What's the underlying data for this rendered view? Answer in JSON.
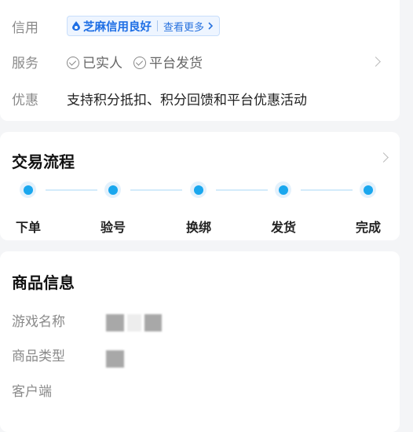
{
  "seller": {
    "credit_label": "信用",
    "credit_badge": "芝麻信用良好",
    "credit_more": "查看更多",
    "service_label": "服务",
    "service_items": [
      "已实人",
      "平台发货"
    ],
    "discount_label": "优惠",
    "discount_text": "支持积分抵扣、积分回馈和平台优惠活动"
  },
  "process": {
    "title": "交易流程",
    "steps": [
      "下单",
      "验号",
      "换绑",
      "发货",
      "完成"
    ]
  },
  "product": {
    "title": "商品信息",
    "fields": [
      "游戏名称",
      "商品类型",
      "客户端"
    ]
  },
  "colors": {
    "accent": "#1aa7ee",
    "badge_blue": "#1f6fe5"
  }
}
